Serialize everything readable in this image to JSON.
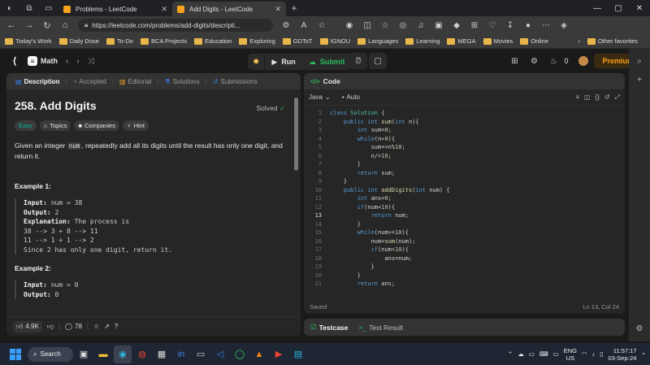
{
  "browser": {
    "tabs": [
      {
        "title": "Problems - LeetCode",
        "active": false
      },
      {
        "title": "Add Digits - LeetCode",
        "active": true
      }
    ],
    "url": "https://leetcode.com/problems/add-digits/descripti...",
    "bookmarks": [
      "Today's Work",
      "Daily Dose",
      "To-Do",
      "BCA Projects",
      "Education",
      "Exploring",
      "GDToT",
      "IGNOU",
      "Languages",
      "Learning",
      "MEGA",
      "Movies",
      "Online"
    ],
    "other_bookmarks": "Other favorites"
  },
  "leetcode": {
    "section": "Math",
    "run": "Run",
    "submit": "Submit",
    "streak": "0",
    "premium": "Premium"
  },
  "problem": {
    "tabs": [
      "Description",
      "Accepted",
      "Editorial",
      "Solutions",
      "Submissions"
    ],
    "title": "258. Add Digits",
    "status": "Solved",
    "tags": [
      "Easy",
      "Topics",
      "Companies",
      "Hint"
    ],
    "desc_pre": "Given an integer ",
    "desc_code": "num",
    "desc_post": ", repeatedly add all its digits until the result has only one digit, and return it.",
    "ex1_title": "Example 1:",
    "ex1_input_label": "Input:",
    "ex1_input": " num = 38",
    "ex1_output_label": "Output:",
    "ex1_output": " 2",
    "ex1_expl_label": "Explanation:",
    "ex1_expl": " The process is",
    "ex1_l1": "38 --> 3 + 8 --> 11",
    "ex1_l2": "11 --> 1 + 1 --> 2",
    "ex1_l3": "Since 2 has only one digit, return it.",
    "ex2_title": "Example 2:",
    "ex2_input_label": "Input:",
    "ex2_input": " num = 0",
    "ex2_output_label": "Output:",
    "ex2_output": " 0",
    "likes": "4.9K",
    "comments": "78"
  },
  "editor": {
    "title": "Code",
    "language": "Java",
    "mode": "Auto",
    "lines": [
      "class Solution {",
      "    public int sum(int n){",
      "        int sum=0;",
      "        while(n>0){",
      "            sum+=n%10;",
      "            n/=10;",
      "        }",
      "        return sum;",
      "    }",
      "    public int addDigits(int num) {",
      "        int ans=0;",
      "        if(num<10){",
      "            return num;",
      "        }",
      "        while(num>=10){",
      "            num=sum(num);",
      "            if(num<10){",
      "                ans=num;",
      "            }",
      "        }",
      "        return ans;"
    ],
    "highlight_line": 13,
    "saved": "Saved",
    "cursor": "Ln 13, Col 24"
  },
  "testcase": {
    "tab1": "Testcase",
    "tab2": "Test Result"
  },
  "taskbar": {
    "search": "Search",
    "lang1": "ENG",
    "lang2": "US",
    "time": "11:57:17",
    "date": "03-Sep-24"
  }
}
